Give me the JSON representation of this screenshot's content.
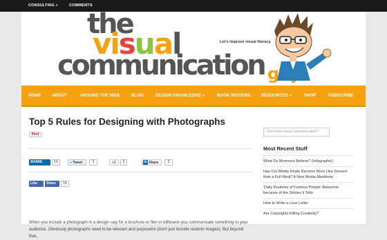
{
  "topbar": {
    "items": [
      {
        "label": "CONSULTING »"
      },
      {
        "label": "COMMENTS"
      }
    ]
  },
  "header": {
    "logo": {
      "line1": "the",
      "line2": "visual",
      "line3": "communication",
      "line4": "guy"
    },
    "tagline": "Let's improve visual literacy."
  },
  "nav": {
    "items": [
      {
        "label": "HOME"
      },
      {
        "label": "ABOUT"
      },
      {
        "label": "AROUND THE WEB"
      },
      {
        "label": "BLOG"
      },
      {
        "label": "DESIGN KNOWLEDGE »"
      },
      {
        "label": "BOOK REVIEWS"
      },
      {
        "label": "RESOURCES »"
      },
      {
        "label": "SHOP"
      },
      {
        "label": "SUBSCRIBE"
      }
    ]
  },
  "post": {
    "title": "Top 5 Rules for Designing with Photographs",
    "pinit": "Pinit",
    "share": {
      "linkedin_label": "SHARE",
      "linkedin_count": "10",
      "tweet_label": "Tweet",
      "tweet_count": "3",
      "gplus_label": "+1",
      "gplus_count": "2",
      "in_share_label": "Share",
      "in_share_count": "3",
      "fb_like": "Like",
      "fb_share": "Share",
      "fb_count": "10"
    },
    "body": "When you include a photograph in a design–say for a brochure or flier or billboard–you communicate something to your audience. Obviously photographs need to be relevant and purposeful (don't just include random images). But beyond that,"
  },
  "sidebar": {
    "search_placeholder": "Find more visual communication?",
    "heading": "Most Recent Stuff",
    "items": [
      {
        "label": "What Do Mormons Believe? (Infographic)"
      },
      {
        "label": "Has Our Media Intake Become More Like Dessert than a Full Meal? A New Media Manifesto"
      },
      {
        "label": "'Daily Routines of Famous People' Awesome because of the Stories It Tells"
      },
      {
        "label": "How to Write a Love Letter"
      },
      {
        "label": "Are Copyrights Killing Creativity?"
      }
    ]
  },
  "colors": {
    "nav": "#f6a10f",
    "logo_gray": "#555555",
    "logo_orange": "#f6a10f",
    "logo_red": "#e8403a",
    "logo_green": "#8cc63f"
  }
}
